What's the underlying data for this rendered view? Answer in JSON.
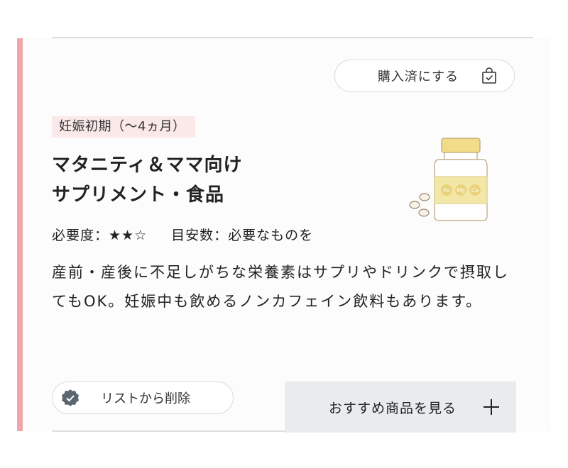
{
  "card": {
    "purchased_button": {
      "label": "購入済にする",
      "icon": "shopping-bag-check-icon"
    },
    "period_tag": "妊娠初期（〜4ヵ月）",
    "title_lines": [
      "マタニティ＆ママ向け",
      "サプリメント・食品"
    ],
    "product_image": {
      "icon": "supplement-bottle-icon",
      "label_text": [
        "Fe",
        "Mg",
        "Ca"
      ]
    },
    "necessity": {
      "label": "必要度：",
      "stars": "★★☆",
      "rating": 2,
      "max": 3
    },
    "quantity": {
      "label": "目安数：",
      "value": "必要なものを"
    },
    "description": "産前・産後に不足しがちな栄養素はサプリやドリンクで摂取してもOK。妊娠中も飲めるノンカフェイン飲料もあります。",
    "remove_button": {
      "label": "リストから削除",
      "icon": "check-badge-icon"
    },
    "recommend_button": {
      "label": "おすすめ商品を見る",
      "icon": "plus-icon"
    }
  },
  "colors": {
    "accent_bar": "#f0a4ab",
    "tag_background": "#fbe8e8",
    "recommend_background": "#e9ebed",
    "check_badge": "#5a6670",
    "bottle_cap": "#f2dc8a",
    "bottle_label": "#f3e7a8"
  }
}
